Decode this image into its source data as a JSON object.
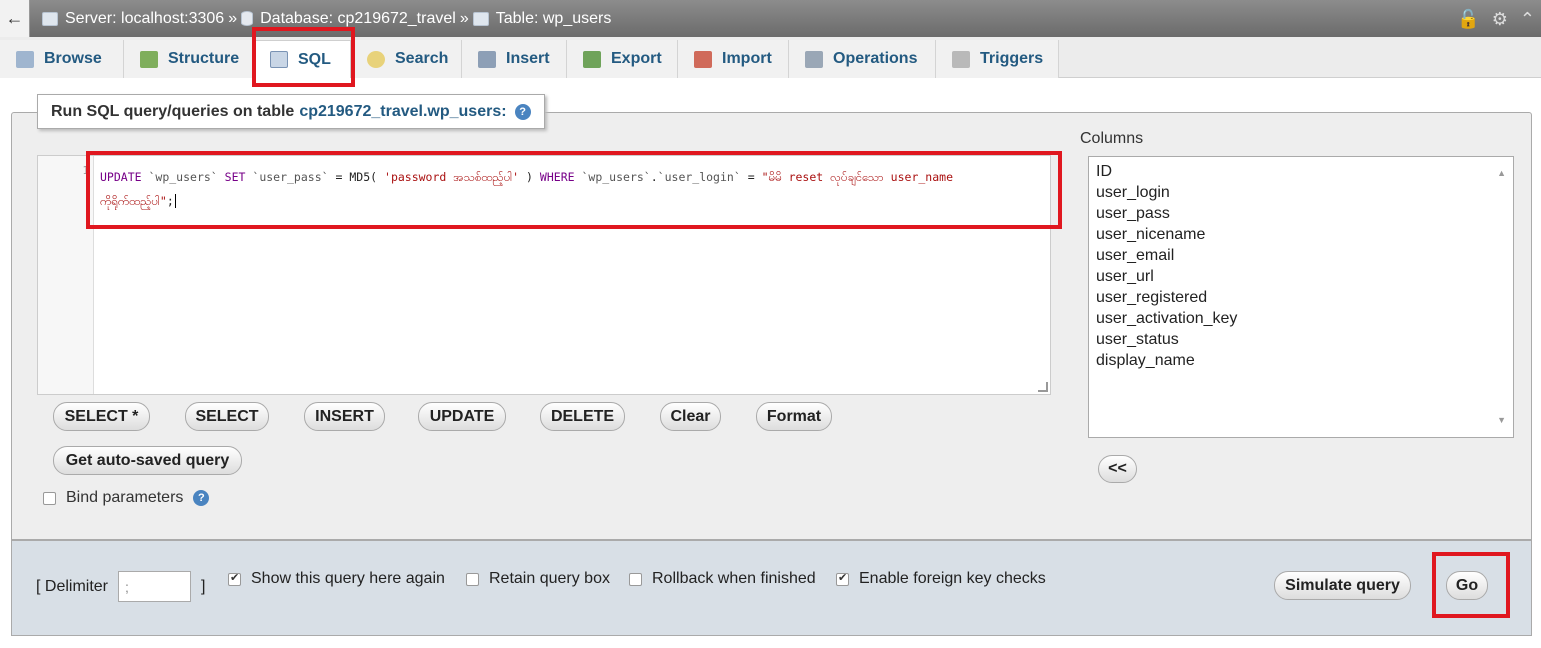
{
  "breadcrumb": {
    "server": "Server: localhost:3306",
    "sep1": "»",
    "database": "Database: cp219672_travel",
    "sep2": "»",
    "table": "Table: wp_users"
  },
  "tabs": [
    {
      "label": "Browse",
      "icon": "browse-icon"
    },
    {
      "label": "Structure",
      "icon": "structure-icon"
    },
    {
      "label": "SQL",
      "icon": "sql-icon",
      "active": true
    },
    {
      "label": "Search",
      "icon": "search-icon"
    },
    {
      "label": "Insert",
      "icon": "insert-icon"
    },
    {
      "label": "Export",
      "icon": "export-icon"
    },
    {
      "label": "Import",
      "icon": "import-icon"
    },
    {
      "label": "Operations",
      "icon": "wrench-icon"
    },
    {
      "label": "Triggers",
      "icon": "triggers-icon"
    }
  ],
  "query_panel": {
    "legend_prefix": "Run SQL query/queries on table",
    "legend_table": "cp219672_travel.wp_users:",
    "line_number": "1",
    "sql": {
      "update": "UPDATE",
      "table": "`wp_users`",
      "set": "SET",
      "col_pass": "`user_pass`",
      "eq1": "=",
      "md5": "MD5(",
      "password_str": "'password အသစ်ထည့်ပါ'",
      "close": ")",
      "where": "WHERE",
      "table2": "`wp_users`",
      "dot": ".",
      "col_login": "`user_login`",
      "eq2": "=",
      "login_str_line1": "\"မိမိ reset လုပ်ချင်သော user_name",
      "login_str_line2": "ကိုရိုက်ထည့်ပါ\"",
      "semicolon": ";"
    },
    "buttons": {
      "select_star": "SELECT *",
      "select": "SELECT",
      "insert": "INSERT",
      "update": "UPDATE",
      "delete": "DELETE",
      "clear": "Clear",
      "format": "Format",
      "get_autosaved": "Get auto-saved query"
    },
    "bind_parameters": "Bind parameters"
  },
  "columns": {
    "label": "Columns",
    "items": [
      "ID",
      "user_login",
      "user_pass",
      "user_nicename",
      "user_email",
      "user_url",
      "user_registered",
      "user_activation_key",
      "user_status",
      "display_name"
    ],
    "insert_button": "<<"
  },
  "footer": {
    "delimiter_open": "[ Delimiter",
    "delimiter_value": ";",
    "delimiter_close": "]",
    "show_query": "Show this query here again",
    "show_query_checked": true,
    "retain_box": "Retain query box",
    "retain_box_checked": false,
    "rollback": "Rollback when finished",
    "rollback_checked": false,
    "foreign_keys": "Enable foreign key checks",
    "foreign_keys_checked": true,
    "simulate": "Simulate query",
    "go": "Go"
  },
  "colors": {
    "highlight": "#e0171f",
    "link": "#235a81"
  }
}
